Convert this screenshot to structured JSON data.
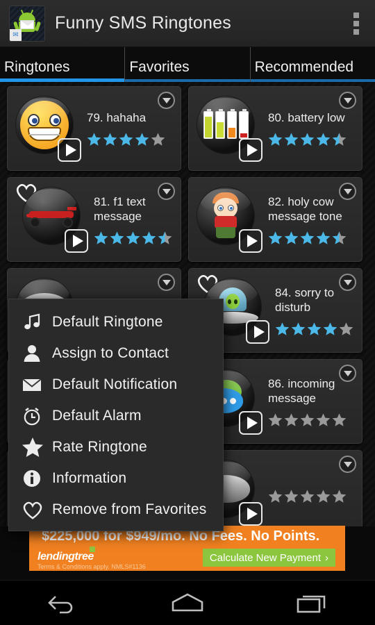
{
  "actionbar": {
    "app_icon_name": "android-envelope-icon",
    "title": "Funny SMS Ringtones",
    "overflow_label": "more-options"
  },
  "tabs": [
    {
      "label": "Ringtones",
      "active": true
    },
    {
      "label": "Favorites",
      "active": false
    },
    {
      "label": "Recommended",
      "active": false
    }
  ],
  "colors": {
    "accent_blue": "#2196e8",
    "star_filled": "#4bb8e8",
    "star_empty": "#9a9a9a",
    "ad_background": "#f08020",
    "ad_button": "#8cc63f"
  },
  "ringtones": [
    {
      "title": "79. hahaha",
      "rating": 4,
      "favorite": false,
      "art": "smiley"
    },
    {
      "title": "80. battery low",
      "rating": 4.5,
      "favorite": false,
      "art": "battery"
    },
    {
      "title": "81. f1 text message",
      "rating": 4.5,
      "favorite": true,
      "art": "f1car"
    },
    {
      "title": "82. holy cow message tone",
      "rating": 4.5,
      "favorite": false,
      "art": "kid"
    },
    {
      "title": "",
      "rating": 0,
      "favorite": false,
      "art": "grayblob"
    },
    {
      "title": "84. sorry to disturb",
      "rating": 4,
      "favorite": true,
      "art": "ufo"
    },
    {
      "title": "",
      "rating": 0,
      "favorite": true,
      "art": "grayblob"
    },
    {
      "title": "86. incoming message",
      "rating": 0,
      "favorite": false,
      "art": "bubble"
    },
    {
      "title": "",
      "rating": 0,
      "favorite": false,
      "art": "grayblob"
    },
    {
      "title": "",
      "rating": 0,
      "favorite": false,
      "art": "grayblob"
    }
  ],
  "context_menu": {
    "items": [
      {
        "label": "Default Ringtone",
        "icon": "music-note-icon"
      },
      {
        "label": "Assign to Contact",
        "icon": "person-icon"
      },
      {
        "label": "Default Notification",
        "icon": "envelope-icon"
      },
      {
        "label": "Default Alarm",
        "icon": "alarm-clock-icon"
      },
      {
        "label": "Rate Ringtone",
        "icon": "star-icon"
      },
      {
        "label": "Information",
        "icon": "info-icon"
      },
      {
        "label": "Remove from Favorites",
        "icon": "heart-icon"
      }
    ]
  },
  "ad": {
    "headline": "$225,000 for $949/mo. No Fees. No Points.",
    "logo": "lendingtree",
    "terms": "Terms & Conditions apply. NMLS#1136",
    "cta": "Calculate New Payment",
    "cta_chevron": "›"
  },
  "navbar": {
    "back": "back-button",
    "home": "home-button",
    "recents": "recents-button"
  }
}
